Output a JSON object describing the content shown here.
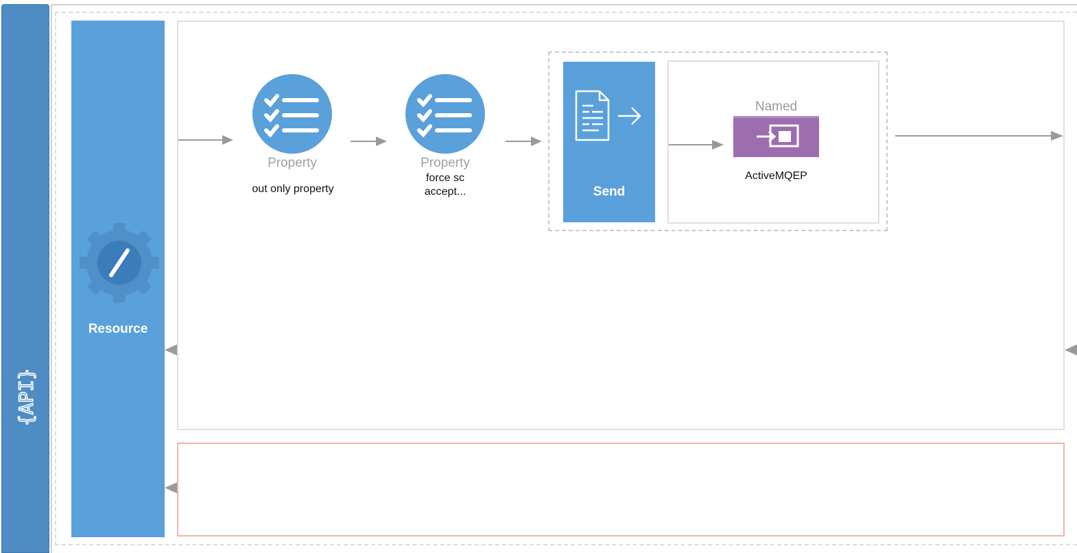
{
  "api_badge": {
    "text": "{API}"
  },
  "resource": {
    "label": "Resource",
    "icon": "gear-pencil-icon"
  },
  "steps": [
    {
      "type": "Property",
      "name": "out only property",
      "icon": "checklist-icon"
    },
    {
      "type": "Property",
      "name_line1": "force sc",
      "name_line2": "accept...",
      "icon": "checklist-icon"
    }
  ],
  "send": {
    "label": "Send",
    "icon": "document-send-icon"
  },
  "endpoint": {
    "type": "Named",
    "name": "ActiveMQEP",
    "icon": "endpoint-enter-icon"
  },
  "colors": {
    "api_bar": "#4f8cc3",
    "resource": "#5aa0db",
    "endpoint": "#9d6ead",
    "error_border": "#ecb6ab",
    "arrow": "#9a9a9a"
  }
}
